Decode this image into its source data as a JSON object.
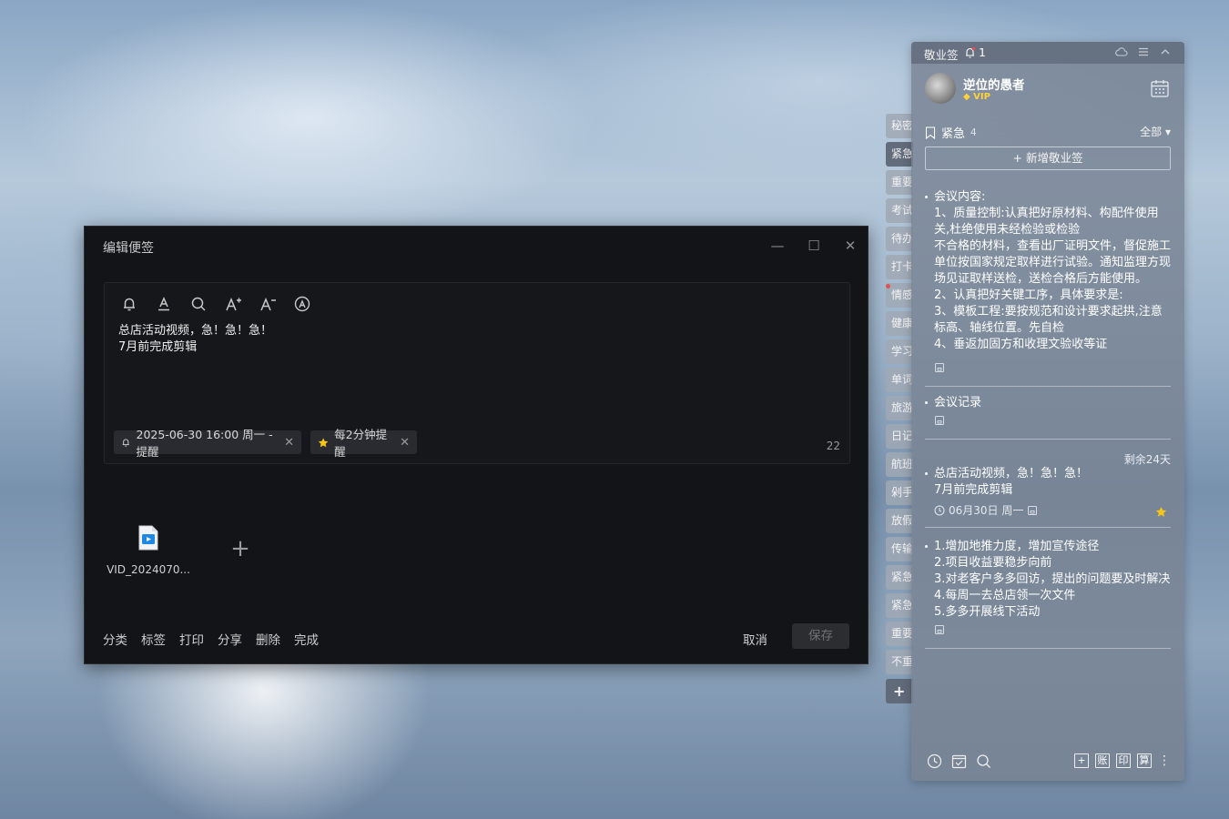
{
  "editor": {
    "title": "编辑便签",
    "content": "总店活动视频，急！急！急！\n7月前完成剪辑",
    "reminder_chip": "2025-06-30 16:00 周一 - 提醒",
    "repeat_chip": "每2分钟提醒",
    "char_count": "22",
    "attachment_name": "VID_2024070...",
    "actions": [
      "分类",
      "标签",
      "打印",
      "分享",
      "删除",
      "完成"
    ],
    "cancel_label": "取消",
    "save_label": "保存"
  },
  "side_tabs": [
    "秘密",
    "紧急",
    "重要",
    "考试",
    "待办",
    "打卡",
    "情感",
    "健康",
    "学习",
    "单词",
    "旅游",
    "日记",
    "航班",
    "剁手",
    "放假",
    "传输",
    "紧急",
    "紧急",
    "重要",
    "不重"
  ],
  "side_tabs_active_index": 1,
  "panel": {
    "app_name": "敬业签",
    "bell_count": "1",
    "username": "逆位的愚者",
    "vip_label": "VIP",
    "category": "紧急",
    "category_count": "4",
    "filter": "全部",
    "new_note_label": "+ 新增敬业签",
    "notes": [
      {
        "text": "会议内容:\n1、质量控制:认真把好原材料、构配件使用关,杜绝使用未经检验或检验\n不合格的材料，查看出厂证明文件，督促施工单位按国家规定取样进行试验。通知监理方现场见证取样送检，送检合格后方能使用。\n2、认真把好关键工序，具体要求是:\n3、模板工程:要按规范和设计要求起拱,注意标高、轴线位置。先自检\n4、垂返加固方和收理文验收等证"
      },
      {
        "text": "会议记录"
      },
      {
        "remaining": "剩余24天",
        "text": "总店活动视频，急！急！急！\n7月前完成剪辑",
        "date": "06月30日 周一"
      },
      {
        "text": "1.增加地推力度，增加宣传途径\n2.项目收益要稳步向前\n3.对老客户多多回访，提出的问题要及时解决\n4.每周一去总店领一次文件\n5.多多开展线下活动"
      }
    ],
    "footer_buttons": [
      "账",
      "印",
      "算"
    ]
  },
  "colors": {
    "star": "#f5c518",
    "vip": "#ffd23a",
    "reminder_dot": "#e05151"
  }
}
